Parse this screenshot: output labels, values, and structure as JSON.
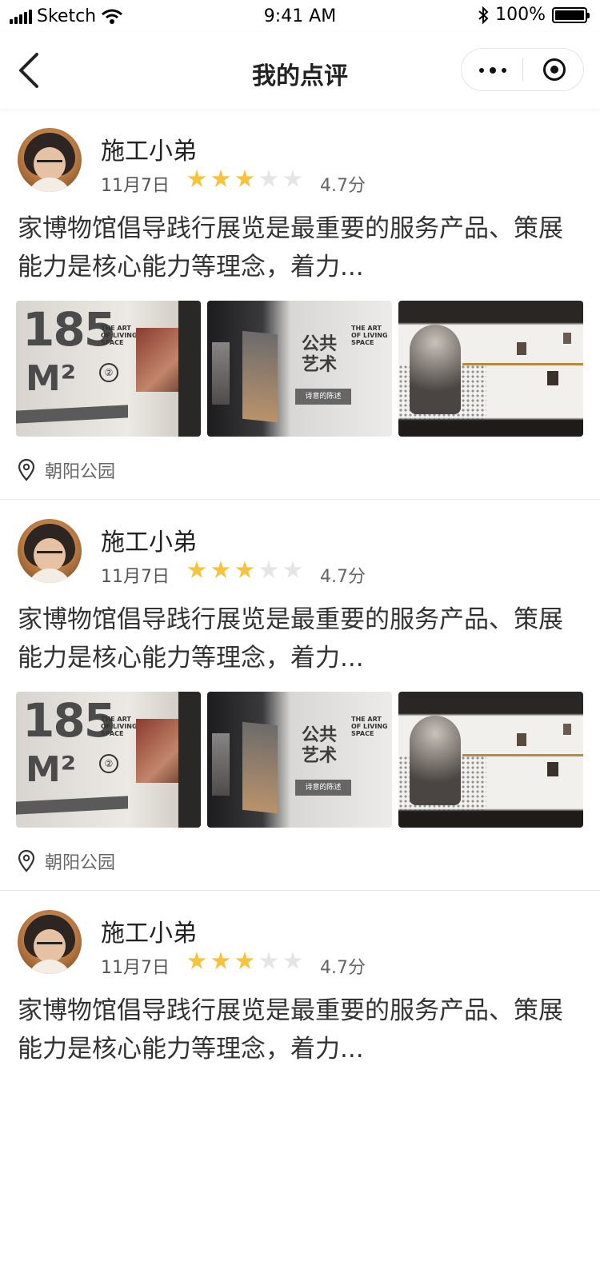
{
  "status_bar": {
    "carrier": "Sketch",
    "time": "9:41 AM",
    "battery": "100%"
  },
  "nav": {
    "title": "我的点评"
  },
  "reviews": [
    {
      "name": "施工小弟",
      "date": "11月7日",
      "rating_stars": 3,
      "score": "4.7分",
      "content": "家博物馆倡导践行展览是最重要的服务产品、策展能力是核心能力等理念，着力...",
      "location": "朝阳公园",
      "photos": {
        "p1_big": "185",
        "p1_m": "M²",
        "p1_art": "THE ART OF LIVING SPACE",
        "p1_num": "②",
        "p2_title": "公共艺术",
        "p2_sub": "诗意的陈述",
        "p2_art": "THE ART OF LIVING SPACE"
      }
    },
    {
      "name": "施工小弟",
      "date": "11月7日",
      "rating_stars": 3,
      "score": "4.7分",
      "content": "家博物馆倡导践行展览是最重要的服务产品、策展能力是核心能力等理念，着力...",
      "location": "朝阳公园",
      "photos": {
        "p1_big": "185",
        "p1_m": "M²",
        "p1_art": "THE ART OF LIVING SPACE",
        "p1_num": "②",
        "p2_title": "公共艺术",
        "p2_sub": "诗意的陈述",
        "p2_art": "THE ART OF LIVING SPACE"
      }
    },
    {
      "name": "施工小弟",
      "date": "11月7日",
      "rating_stars": 3,
      "score": "4.7分",
      "content": "家博物馆倡导践行展览是最重要的服务产品、策展能力是核心能力等理念，着力...",
      "location": "朝阳公园"
    }
  ],
  "colors": {
    "star_on": "#f7c23c",
    "star_off": "#e5e5e5"
  }
}
